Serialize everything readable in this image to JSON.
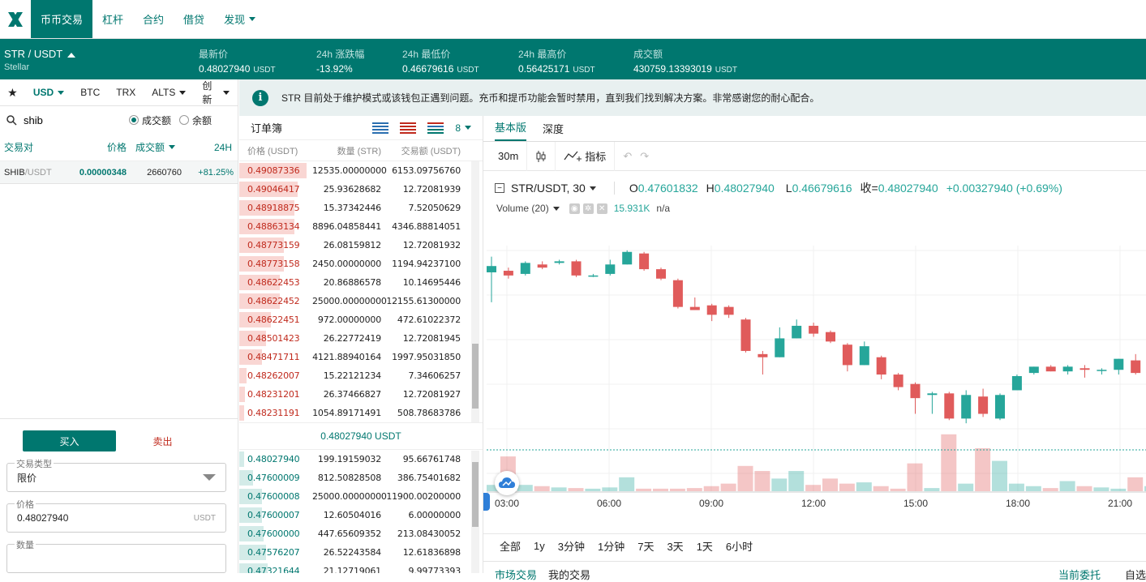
{
  "nav": {
    "logo": "X",
    "items": [
      "币币交易",
      "杠杆",
      "合约",
      "借贷",
      "发现"
    ]
  },
  "ticker": {
    "pair": "STR / USDT",
    "subname": "Stellar",
    "stats": [
      {
        "label": "最新价",
        "value": "0.48027940",
        "unit": "USDT"
      },
      {
        "label": "24h 涨跌幅",
        "value": "-13.92%",
        "unit": ""
      },
      {
        "label": "24h 最低价",
        "value": "0.46679616",
        "unit": "USDT"
      },
      {
        "label": "24h 最高价",
        "value": "0.56425171",
        "unit": "USDT"
      },
      {
        "label": "成交额",
        "value": "430759.13393019",
        "unit": "USDT"
      }
    ]
  },
  "markets": {
    "tabs": [
      "USD",
      "BTC",
      "TRX",
      "ALTS",
      "创新"
    ],
    "search_value": "shib",
    "radio": [
      "成交额",
      "余额"
    ],
    "headers": {
      "pair": "交易对",
      "price": "价格",
      "volume": "成交额",
      "change": "24H"
    },
    "rows": [
      {
        "base": "SHIB",
        "quote": "/USDT",
        "price": "0.00000348",
        "volume": "2660760",
        "change": "+81.25%"
      }
    ]
  },
  "trade": {
    "buy": "买入",
    "sell": "卖出",
    "type_label": "交易类型",
    "type_value": "限价",
    "price_label": "价格",
    "price_value": "0.48027940",
    "price_unit": "USDT",
    "qty_label": "数量"
  },
  "notice": {
    "text": "STR 目前处于维护模式或该钱包正遇到问题。充币和提币功能会暂时禁用，直到我们找到解决方案。非常感谢您的耐心配合。"
  },
  "orderbook": {
    "title": "订单簿",
    "decimals": "8",
    "cols": [
      "价格 (USDT)",
      "数量 (STR)",
      "交易额 (USDT)"
    ],
    "asks": [
      {
        "price": "0.49087336",
        "qty": "12535.00000000",
        "total": "6153.09756760",
        "depth": 0.75
      },
      {
        "price": "0.49046417",
        "qty": "25.93628682",
        "total": "12.72081939",
        "depth": 0.65
      },
      {
        "price": "0.48918875",
        "qty": "15.37342446",
        "total": "7.52050629",
        "depth": 0.62
      },
      {
        "price": "0.48863134",
        "qty": "8896.04858441",
        "total": "4346.88814051",
        "depth": 0.62
      },
      {
        "price": "0.48773159",
        "qty": "26.08159812",
        "total": "12.72081932",
        "depth": 0.5
      },
      {
        "price": "0.48773158",
        "qty": "2450.00000000",
        "total": "1194.94237100",
        "depth": 0.5
      },
      {
        "price": "0.48622453",
        "qty": "20.86886578",
        "total": "10.14695446",
        "depth": 0.45
      },
      {
        "price": "0.48622452",
        "qty": "25000.00000000",
        "total": "12155.61300000",
        "depth": 0.45
      },
      {
        "price": "0.48622451",
        "qty": "972.00000000",
        "total": "472.61022372",
        "depth": 0.35
      },
      {
        "price": "0.48501423",
        "qty": "26.22772419",
        "total": "12.72081945",
        "depth": 0.3
      },
      {
        "price": "0.48471711",
        "qty": "4121.88940164",
        "total": "1997.95031850",
        "depth": 0.25
      },
      {
        "price": "0.48262007",
        "qty": "15.22121234",
        "total": "7.34606257",
        "depth": 0.08
      },
      {
        "price": "0.48231201",
        "qty": "26.37466827",
        "total": "12.72081927",
        "depth": 0.06
      },
      {
        "price": "0.48231191",
        "qty": "1054.89171491",
        "total": "508.78683786",
        "depth": 0.05
      }
    ],
    "last": "0.48027940 USDT",
    "bids": [
      {
        "price": "0.48027940",
        "qty": "199.19159032",
        "total": "95.66761748",
        "depth": 0.05
      },
      {
        "price": "0.47600009",
        "qty": "812.50828508",
        "total": "386.75401682",
        "depth": 0.15
      },
      {
        "price": "0.47600008",
        "qty": "25000.00000000",
        "total": "11900.00200000",
        "depth": 0.25
      },
      {
        "price": "0.47600007",
        "qty": "12.60504016",
        "total": "6.00000000",
        "depth": 0.25
      },
      {
        "price": "0.47600000",
        "qty": "447.65609352",
        "total": "213.08430052",
        "depth": 0.27
      },
      {
        "price": "0.47576207",
        "qty": "26.52243584",
        "total": "12.61836898",
        "depth": 0.3
      },
      {
        "price": "0.47321644",
        "qty": "21.12719061",
        "total": "9.99773393",
        "depth": 0.32
      }
    ]
  },
  "chart": {
    "tabs": [
      "基本版",
      "深度"
    ],
    "interval": "30m",
    "indicator_label": "指标",
    "symbol": "STR/USDT, 30",
    "ohlc": {
      "o_label": "O",
      "o": "0.47601832",
      "h_label": "H",
      "h": "0.48027940",
      "l_label": "L",
      "l": "0.46679616",
      "c_label": "收=",
      "c": "0.48027940",
      "chg": "+0.00327940 (+0.69%)"
    },
    "volume_label": "Volume (20)",
    "volume_value": "15.931K",
    "volume_na": "n/a",
    "ranges": [
      "全部",
      "1y",
      "3分钟",
      "1分钟",
      "7天",
      "3天",
      "1天",
      "6小时"
    ],
    "bottom_tabs": [
      "市场交易",
      "我的交易",
      "当前委托",
      "自选"
    ],
    "colors": {
      "up": "#26a69a",
      "down": "#e05b5b"
    }
  },
  "chart_data": {
    "type": "candlestick",
    "x_ticks": [
      "03:00",
      "06:00",
      "09:00",
      "12:00",
      "15:00",
      "18:00",
      "21:00"
    ],
    "candles": [
      {
        "o": 0.4735,
        "h": 0.4745,
        "l": 0.4716,
        "c": 0.4739,
        "v": 10
      },
      {
        "o": 0.4736,
        "h": 0.4738,
        "l": 0.4731,
        "c": 0.4733,
        "v": 55
      },
      {
        "o": 0.4734,
        "h": 0.4742,
        "l": 0.4733,
        "c": 0.4741,
        "v": 10
      },
      {
        "o": 0.474,
        "h": 0.4742,
        "l": 0.4737,
        "c": 0.4738,
        "v": 8
      },
      {
        "o": 0.4741,
        "h": 0.4743,
        "l": 0.474,
        "c": 0.4742,
        "v": 6
      },
      {
        "o": 0.4742,
        "h": 0.4743,
        "l": 0.4732,
        "c": 0.4733,
        "v": 5
      },
      {
        "o": 0.4733,
        "h": 0.4734,
        "l": 0.4732,
        "c": 0.4733,
        "v": 4
      },
      {
        "o": 0.4734,
        "h": 0.4743,
        "l": 0.4733,
        "c": 0.474,
        "v": 6
      },
      {
        "o": 0.474,
        "h": 0.4749,
        "l": 0.474,
        "c": 0.4748,
        "v": 22
      },
      {
        "o": 0.4747,
        "h": 0.4748,
        "l": 0.4736,
        "c": 0.4737,
        "v": 4
      },
      {
        "o": 0.4737,
        "h": 0.4738,
        "l": 0.473,
        "c": 0.4731,
        "v": 4
      },
      {
        "o": 0.473,
        "h": 0.4731,
        "l": 0.4712,
        "c": 0.4713,
        "v": 4
      },
      {
        "o": 0.4713,
        "h": 0.4719,
        "l": 0.4711,
        "c": 0.4711,
        "v": 5
      },
      {
        "o": 0.4714,
        "h": 0.4715,
        "l": 0.4704,
        "c": 0.4708,
        "v": 8
      },
      {
        "o": 0.4713,
        "h": 0.4714,
        "l": 0.4706,
        "c": 0.4708,
        "v": 12
      },
      {
        "o": 0.4705,
        "h": 0.4706,
        "l": 0.4684,
        "c": 0.4685,
        "v": 40
      },
      {
        "o": 0.4683,
        "h": 0.4685,
        "l": 0.467,
        "c": 0.4681,
        "v": 32
      },
      {
        "o": 0.4681,
        "h": 0.47,
        "l": 0.4681,
        "c": 0.4693,
        "v": 20
      },
      {
        "o": 0.4693,
        "h": 0.4705,
        "l": 0.4693,
        "c": 0.4701,
        "v": 32
      },
      {
        "o": 0.4701,
        "h": 0.4703,
        "l": 0.4694,
        "c": 0.4696,
        "v": 10
      },
      {
        "o": 0.4697,
        "h": 0.4698,
        "l": 0.469,
        "c": 0.4691,
        "v": 20
      },
      {
        "o": 0.4689,
        "h": 0.469,
        "l": 0.4672,
        "c": 0.4676,
        "v": 12
      },
      {
        "o": 0.4676,
        "h": 0.4691,
        "l": 0.4676,
        "c": 0.4688,
        "v": 14
      },
      {
        "o": 0.4681,
        "h": 0.4682,
        "l": 0.4667,
        "c": 0.467,
        "v": 8
      },
      {
        "o": 0.467,
        "h": 0.4671,
        "l": 0.466,
        "c": 0.4662,
        "v": 4
      },
      {
        "o": 0.4664,
        "h": 0.4665,
        "l": 0.4645,
        "c": 0.4655,
        "v": 44
      },
      {
        "o": 0.4657,
        "h": 0.4659,
        "l": 0.4645,
        "c": 0.4658,
        "v": 5
      },
      {
        "o": 0.4658,
        "h": 0.4659,
        "l": 0.4641,
        "c": 0.4642,
        "v": 90
      },
      {
        "o": 0.4642,
        "h": 0.466,
        "l": 0.4639,
        "c": 0.4657,
        "v": 12
      },
      {
        "o": 0.4656,
        "h": 0.4661,
        "l": 0.4643,
        "c": 0.4645,
        "v": 68
      },
      {
        "o": 0.4642,
        "h": 0.4658,
        "l": 0.4641,
        "c": 0.4657,
        "v": 48
      },
      {
        "o": 0.466,
        "h": 0.467,
        "l": 0.466,
        "c": 0.4669,
        "v": 12
      },
      {
        "o": 0.4671,
        "h": 0.4675,
        "l": 0.467,
        "c": 0.4675,
        "v": 8
      },
      {
        "o": 0.4675,
        "h": 0.4676,
        "l": 0.4672,
        "c": 0.4672,
        "v": 5
      },
      {
        "o": 0.4672,
        "h": 0.4676,
        "l": 0.467,
        "c": 0.4675,
        "v": 16
      },
      {
        "o": 0.4674,
        "h": 0.4676,
        "l": 0.4668,
        "c": 0.4673,
        "v": 8
      },
      {
        "o": 0.4673,
        "h": 0.4674,
        "l": 0.467,
        "c": 0.4673,
        "v": 6
      },
      {
        "o": 0.4673,
        "h": 0.468,
        "l": 0.467,
        "c": 0.468,
        "v": 4
      },
      {
        "o": 0.4679,
        "h": 0.4683,
        "l": 0.467,
        "c": 0.4671,
        "v": 22
      },
      {
        "o": 0.4671,
        "h": 0.4684,
        "l": 0.4671,
        "c": 0.468,
        "v": 8
      }
    ]
  }
}
